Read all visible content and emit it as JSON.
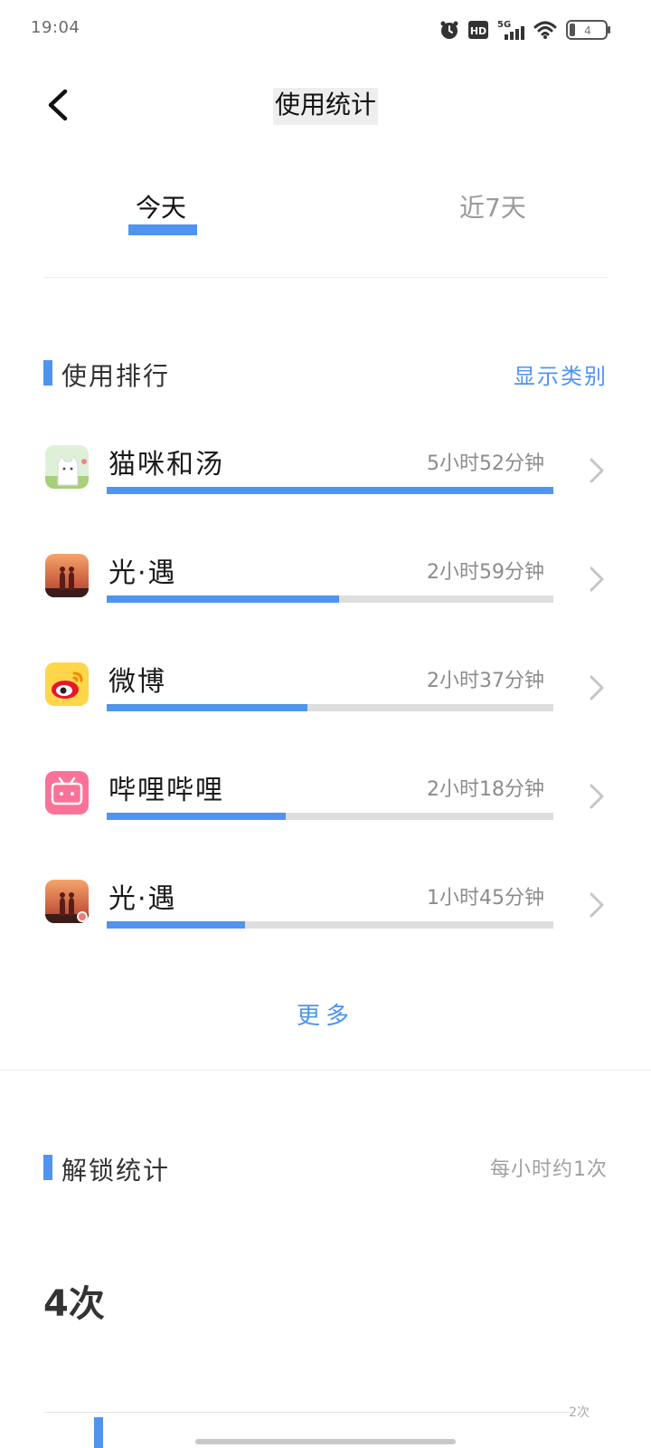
{
  "status_bar": {
    "time": "19:04",
    "network": "5G",
    "hd": "HD",
    "battery_level": "4"
  },
  "header": {
    "title": "使用统计"
  },
  "tabs": [
    {
      "label": "今天",
      "active": true
    },
    {
      "label": "近7天",
      "active": false
    }
  ],
  "usage_ranking": {
    "title": "使用排行",
    "show_category_label": "显示类别",
    "apps": [
      {
        "name": "猫咪和汤",
        "time": "5小时52分钟",
        "fraction": 1.0,
        "icon": "cat-soup-icon"
      },
      {
        "name": "光·遇",
        "time": "2小时59分钟",
        "fraction": 0.52,
        "icon": "sky-icon"
      },
      {
        "name": "微博",
        "time": "2小时37分钟",
        "fraction": 0.45,
        "icon": "weibo-icon"
      },
      {
        "name": "哔哩哔哩",
        "time": "2小时18分钟",
        "fraction": 0.4,
        "icon": "bilibili-icon"
      },
      {
        "name": "光·遇",
        "time": "1小时45分钟",
        "fraction": 0.31,
        "icon": "sky-clone-icon"
      }
    ],
    "more_label": "更多"
  },
  "unlock_stats": {
    "title": "解锁统计",
    "note": "每小时约1次",
    "count": "4次",
    "chart_tick": "2次"
  },
  "colors": {
    "accent": "#4f94ef",
    "track": "#dedede"
  }
}
